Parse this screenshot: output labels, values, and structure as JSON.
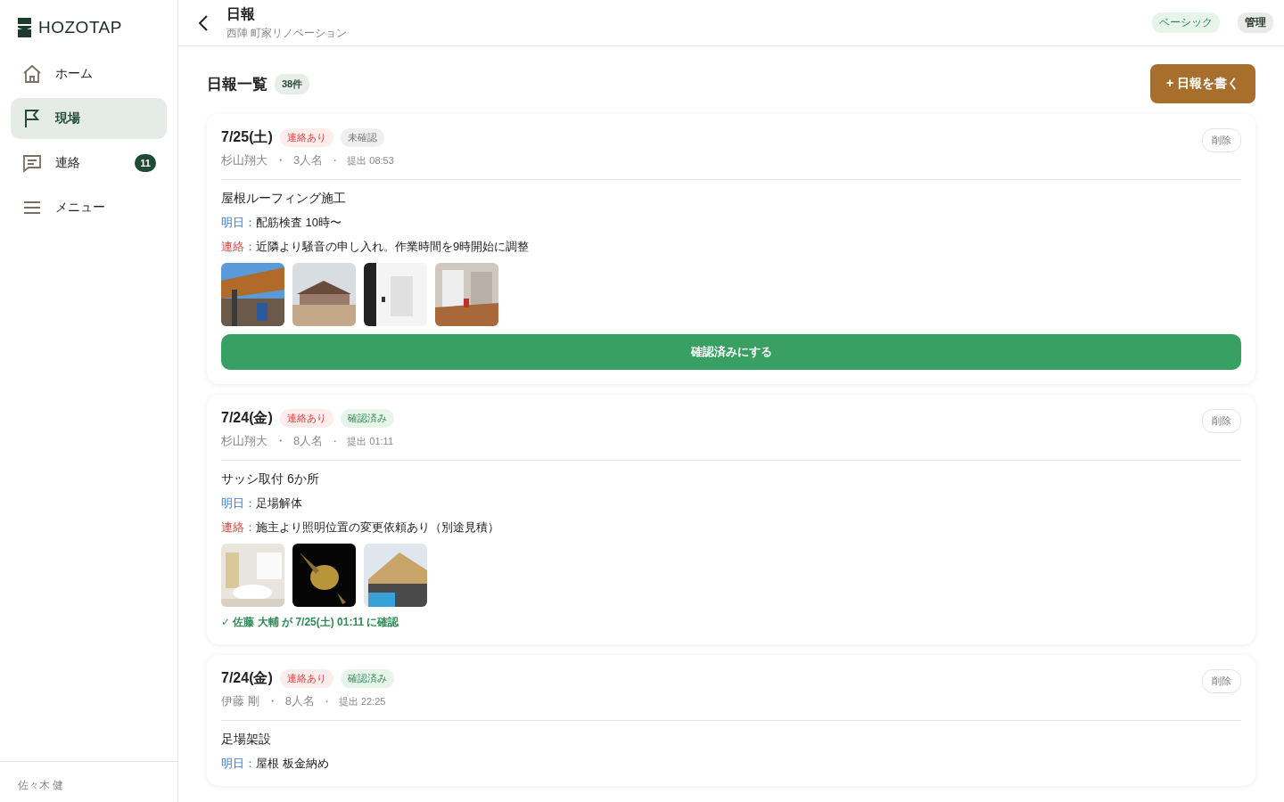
{
  "brand": {
    "name": "HOZOTAP"
  },
  "nav": [
    {
      "kind": "home",
      "label": "ホーム",
      "selected": false
    },
    {
      "kind": "site",
      "label": "現場",
      "selected": true
    },
    {
      "kind": "contact",
      "label": "連絡",
      "selected": false,
      "badge": "11"
    },
    {
      "kind": "menu",
      "label": "メニュー",
      "selected": false
    }
  ],
  "user": {
    "name": "佐々木 健"
  },
  "header": {
    "title": "日報",
    "subtitle": "西陣 町家リノベーション",
    "badges": [
      {
        "label": "ベーシック",
        "kind": "plan"
      },
      {
        "label": "管理",
        "kind": "role"
      }
    ]
  },
  "list": {
    "title": "日報一覧",
    "count": "38件",
    "new_button": "+ 日報を書く"
  },
  "reports": [
    {
      "date": "7/25(土)",
      "tags": [
        {
          "label": "連絡あり",
          "kind": "contact"
        },
        {
          "label": "未確認",
          "kind": "pending"
        }
      ],
      "author": "杉山翔大",
      "separator": "・",
      "workers": "3人名",
      "submitted": "提出 08:53",
      "delete": "削除",
      "work": "屋根ルーフィング施工",
      "notes": [
        {
          "kind": "tomorrow",
          "label": "明日：",
          "text": "配筋検査 10時〜"
        },
        {
          "kind": "contact",
          "label": "連絡：",
          "text": "近隣より騒音の申し入れ。作業時間を9時開始に調整"
        }
      ],
      "photos": [
        {
          "kind": "picture"
        },
        {
          "kind": "picture"
        },
        {
          "kind": "picture"
        },
        {
          "kind": "picture"
        }
      ],
      "confirm_button": "確認済みにする"
    },
    {
      "date": "7/24(金)",
      "tags": [
        {
          "label": "連絡あり",
          "kind": "contact"
        },
        {
          "label": "確認済み",
          "kind": "confirmed"
        }
      ],
      "author": "杉山翔大",
      "separator": "・",
      "workers": "8人名",
      "submitted": "提出 01:11",
      "delete": "削除",
      "work": "サッシ取付 6か所",
      "notes": [
        {
          "kind": "tomorrow",
          "label": "明日：",
          "text": "足場解体"
        },
        {
          "kind": "contact",
          "label": "連絡：",
          "text": "施主より照明位置の変更依頼あり（別途見積）"
        }
      ],
      "photos": [
        {
          "kind": "picture"
        },
        {
          "kind": "picture"
        },
        {
          "kind": "picture"
        }
      ],
      "confirmed_note": "✓ 佐藤 大輔 が 7/25(土) 01:11 に確認"
    },
    {
      "date": "7/24(金)",
      "tags": [
        {
          "label": "連絡あり",
          "kind": "contact"
        },
        {
          "label": "確認済み",
          "kind": "confirmed"
        }
      ],
      "author": "伊藤 剛",
      "separator": "・",
      "workers": "8人名",
      "submitted": "提出 22:25",
      "delete": "削除",
      "work": "足場架設",
      "notes": [
        {
          "kind": "tomorrow",
          "label": "明日：",
          "text": "屋根 板金納め"
        }
      ]
    }
  ]
}
